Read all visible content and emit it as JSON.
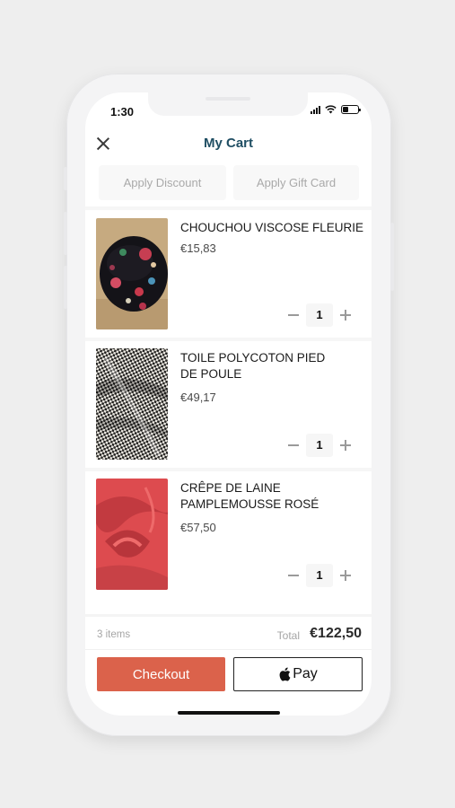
{
  "status_bar": {
    "time": "1:30",
    "battery_level": 0.4
  },
  "header": {
    "title": "My Cart",
    "close_icon": "close-icon"
  },
  "promo": {
    "discount_label": "Apply Discount",
    "gift_card_label": "Apply Gift Card"
  },
  "cart": {
    "items": [
      {
        "name": "CHOUCHOU VISCOSE FLEURIE",
        "price": "€15,83",
        "quantity": "1"
      },
      {
        "name": "TOILE POLYCOTON PIED DE POULE",
        "price": "€49,17",
        "quantity": "1"
      },
      {
        "name": "CRÊPE DE LAINE PAMPLEMOUSSE ROSÉ",
        "price": "€57,50",
        "quantity": "1"
      }
    ]
  },
  "summary": {
    "items_count": "3 items",
    "total_label": "Total",
    "total_value": "€122,50"
  },
  "actions": {
    "checkout_label": "Checkout",
    "apple_pay_label": "Pay"
  },
  "colors": {
    "accent": "#db624b",
    "title": "#1f4e63"
  }
}
